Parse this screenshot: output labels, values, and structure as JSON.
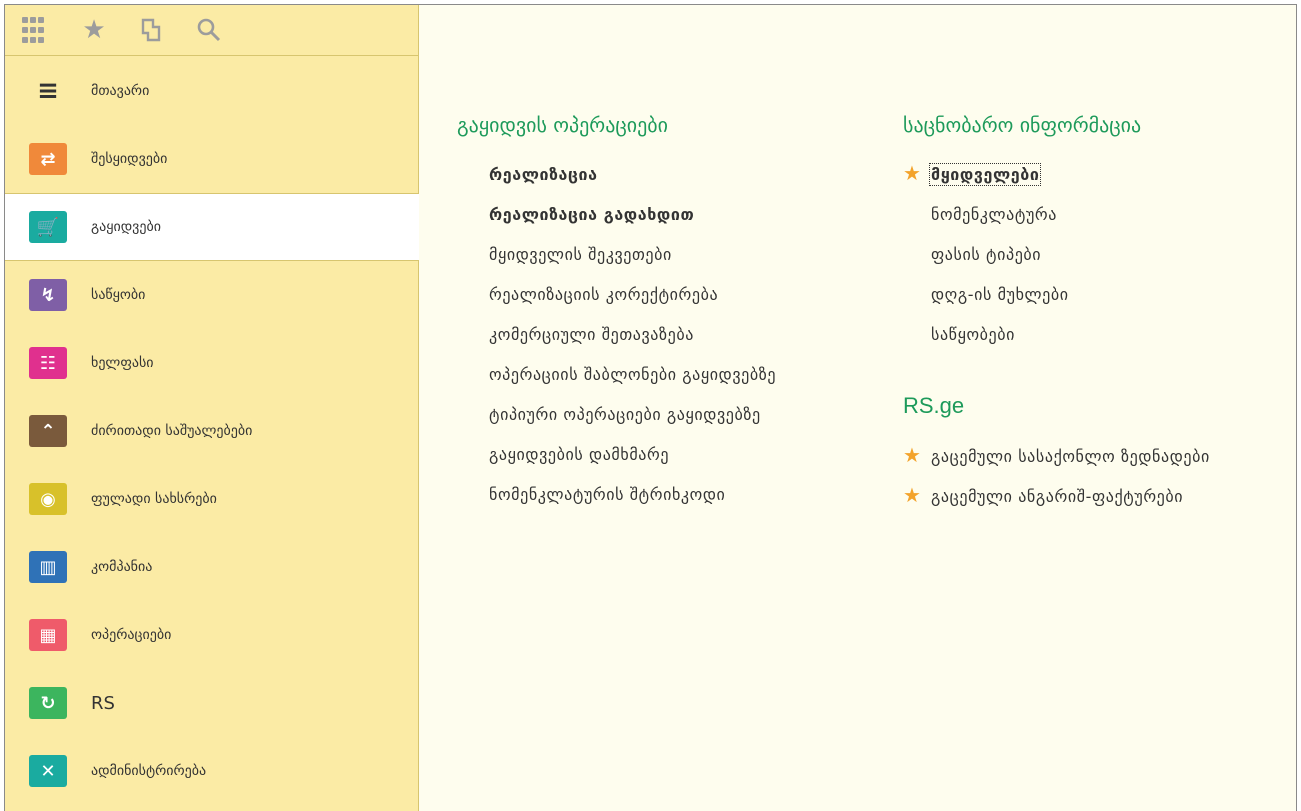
{
  "sidebar": {
    "items": [
      {
        "label": "მთავარი",
        "icon": "menu-icon",
        "color": "transparent",
        "glyph": "≡"
      },
      {
        "label": "შესყიდვები",
        "icon": "handshake-icon",
        "color": "#f0893a",
        "glyph": "⇄"
      },
      {
        "label": "გაყიდვები",
        "icon": "cart-icon",
        "color": "#1aaba0",
        "glyph": "🛒"
      },
      {
        "label": "საწყობი",
        "icon": "hand-truck-icon",
        "color": "#7f5fa6",
        "glyph": "↯"
      },
      {
        "label": "ხელფასი",
        "icon": "people-icon",
        "color": "#e0308e",
        "glyph": "☷"
      },
      {
        "label": "ძირითადი საშუალებები",
        "icon": "chevron-up-icon",
        "color": "#7a5a3c",
        "glyph": "⌃"
      },
      {
        "label": "ფულადი სახსრები",
        "icon": "coin-icon",
        "color": "#d8c12a",
        "glyph": "◉"
      },
      {
        "label": "კომპანია",
        "icon": "building-icon",
        "color": "#2f72b7",
        "glyph": "▥"
      },
      {
        "label": "ოპერაციები",
        "icon": "calculator-icon",
        "color": "#ef5b6a",
        "glyph": "▦"
      },
      {
        "label": "RS",
        "icon": "refresh-icon",
        "color": "#3cb55e",
        "glyph": "↻"
      },
      {
        "label": "ადმინისტრირება",
        "icon": "tools-icon",
        "color": "#1aaba0",
        "glyph": "✕"
      }
    ],
    "active_index": 2
  },
  "sales": {
    "title": "გაყიდვის ოპერაციები",
    "links": [
      {
        "label": "რეალიზაცია",
        "bold": true
      },
      {
        "label": "რეალიზაცია გადახდით",
        "bold": true
      },
      {
        "label": "მყიდველის შეკვეთები",
        "bold": false
      },
      {
        "label": "რეალიზაციის კორექტირება",
        "bold": false
      },
      {
        "label": "კომერციული შეთავაზება",
        "bold": false
      },
      {
        "label": "ოპერაციის შაბლონები გაყიდვებზე",
        "bold": false
      },
      {
        "label": "ტიპიური ოპერაციები გაყიდვებზე",
        "bold": false
      },
      {
        "label": "გაყიდვების დამხმარე",
        "bold": false
      },
      {
        "label": "ნომენკლატურის შტრიხკოდი",
        "bold": false
      }
    ]
  },
  "reference": {
    "title": "საცნობარო ინფორმაცია",
    "links": [
      {
        "label": "მყიდველები",
        "favorite": true
      },
      {
        "label": "ნომენკლატურა",
        "favorite": false
      },
      {
        "label": "ფასის ტიპები",
        "favorite": false
      },
      {
        "label": "დღგ-ის მუხლები",
        "favorite": false
      },
      {
        "label": "საწყობები",
        "favorite": false
      }
    ]
  },
  "rs": {
    "title": "RS.ge",
    "links": [
      {
        "label": "გაცემული სასაქონლო ზედნადები",
        "favorite": true
      },
      {
        "label": "გაცემული ანგარიშ-ფაქტურები",
        "favorite": true
      }
    ]
  },
  "colors": {
    "section_title": "#1d9a5a",
    "favorite_star": "#f3a32b",
    "sidebar_bg": "#fbeba5"
  }
}
